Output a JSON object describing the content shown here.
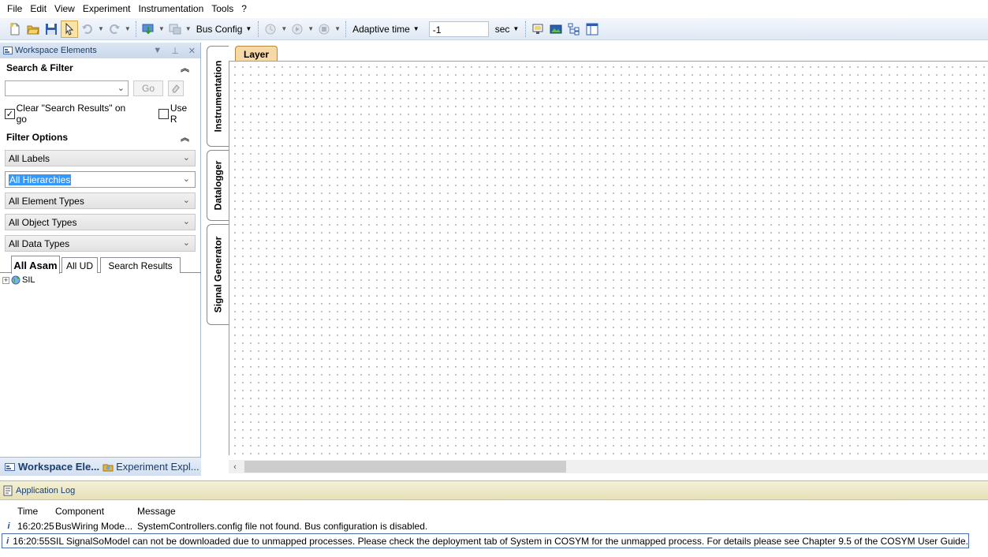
{
  "menu": [
    "File",
    "Edit",
    "View",
    "Experiment",
    "Instrumentation",
    "Tools",
    "?"
  ],
  "toolbar": {
    "bus_config": "Bus Config",
    "time_mode": "Adaptive time",
    "time_value": "-1",
    "time_unit": "sec"
  },
  "workspace": {
    "title": "Workspace Elements",
    "search_section": "Search & Filter",
    "go_label": "Go",
    "clear_checkbox_label": "Clear \"Search Results\" on go",
    "use_checkbox_label": "Use R",
    "filter_section": "Filter Options",
    "filters": [
      "All Labels",
      "All Hierarchies",
      "All Element Types",
      "All Object Types",
      "All Data Types"
    ],
    "tabs": [
      "All Asam",
      "All UD",
      "Search Results"
    ],
    "tree_items": [
      "SIL"
    ],
    "bottom_tabs": [
      "Workspace Ele...",
      "Experiment Expl..."
    ]
  },
  "vertical_tabs": [
    "Instrumentation",
    "Datalogger",
    "Signal Generator"
  ],
  "canvas": {
    "layer_tab": "Layer"
  },
  "log": {
    "title": "Application Log",
    "columns": [
      "Time",
      "Component",
      "Message"
    ],
    "rows": [
      {
        "time": "16:20:25",
        "component": "BusWiring Mode...",
        "message": "SystemControllers.config file not found. Bus configuration is disabled."
      },
      {
        "time": "16:20:55",
        "component": "SIL SignalSource",
        "message": "Model can not be downloaded due to unmapped processes. Please check the deployment tab of System in COSYM for the unmapped process. For details please see Chapter 9.5 of the COSYM User Guide."
      }
    ]
  }
}
